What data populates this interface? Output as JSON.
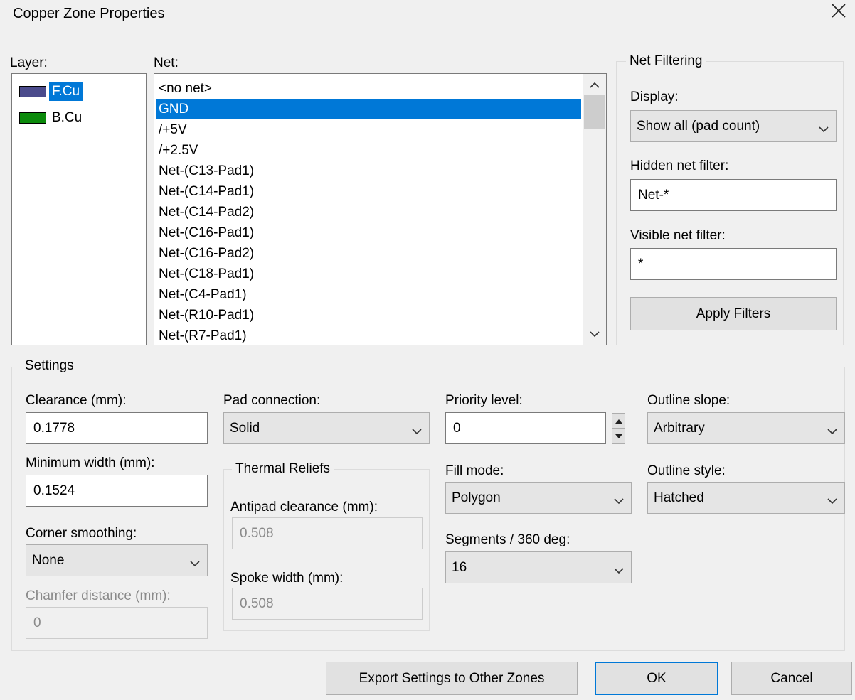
{
  "window": {
    "title": "Copper Zone Properties"
  },
  "layer": {
    "label": "Layer:",
    "items": [
      {
        "name": "F.Cu",
        "color": "#4b4b8c",
        "selected": true
      },
      {
        "name": "B.Cu",
        "color": "#0b8a0b",
        "selected": false
      }
    ]
  },
  "net": {
    "label": "Net:",
    "items": [
      "<no net>",
      "GND",
      "/+5V",
      "/+2.5V",
      "Net-(C13-Pad1)",
      "Net-(C14-Pad1)",
      "Net-(C14-Pad2)",
      "Net-(C16-Pad1)",
      "Net-(C16-Pad2)",
      "Net-(C18-Pad1)",
      "Net-(C4-Pad1)",
      "Net-(R10-Pad1)",
      "Net-(R7-Pad1)"
    ],
    "selected": "GND"
  },
  "net_filtering": {
    "title": "Net Filtering",
    "display_label": "Display:",
    "display_value": "Show all (pad count)",
    "hidden_label": "Hidden net filter:",
    "hidden_value": "Net-*",
    "visible_label": "Visible net filter:",
    "visible_value": "*",
    "apply_label": "Apply Filters"
  },
  "settings": {
    "title": "Settings",
    "clearance_label": "Clearance (mm):",
    "clearance_value": "0.1778",
    "min_width_label": "Minimum width (mm):",
    "min_width_value": "0.1524",
    "corner_label": "Corner smoothing:",
    "corner_value": "None",
    "chamfer_label": "Chamfer distance (mm):",
    "chamfer_value": "0",
    "pad_conn_label": "Pad connection:",
    "pad_conn_value": "Solid",
    "thermal_title": "Thermal Reliefs",
    "antipad_label": "Antipad clearance (mm):",
    "antipad_value": "0.508",
    "spoke_label": "Spoke width (mm):",
    "spoke_value": "0.508",
    "priority_label": "Priority level:",
    "priority_value": "0",
    "fill_label": "Fill mode:",
    "fill_value": "Polygon",
    "segments_label": "Segments / 360 deg:",
    "segments_value": "16",
    "slope_label": "Outline slope:",
    "slope_value": "Arbitrary",
    "style_label": "Outline style:",
    "style_value": "Hatched"
  },
  "buttons": {
    "export": "Export Settings to Other Zones",
    "ok": "OK",
    "cancel": "Cancel"
  },
  "icons": {
    "close": "close-icon",
    "chevron": "chevron-down-icon",
    "scroll_up": "chevron-up-icon",
    "scroll_down": "chevron-down-icon"
  }
}
